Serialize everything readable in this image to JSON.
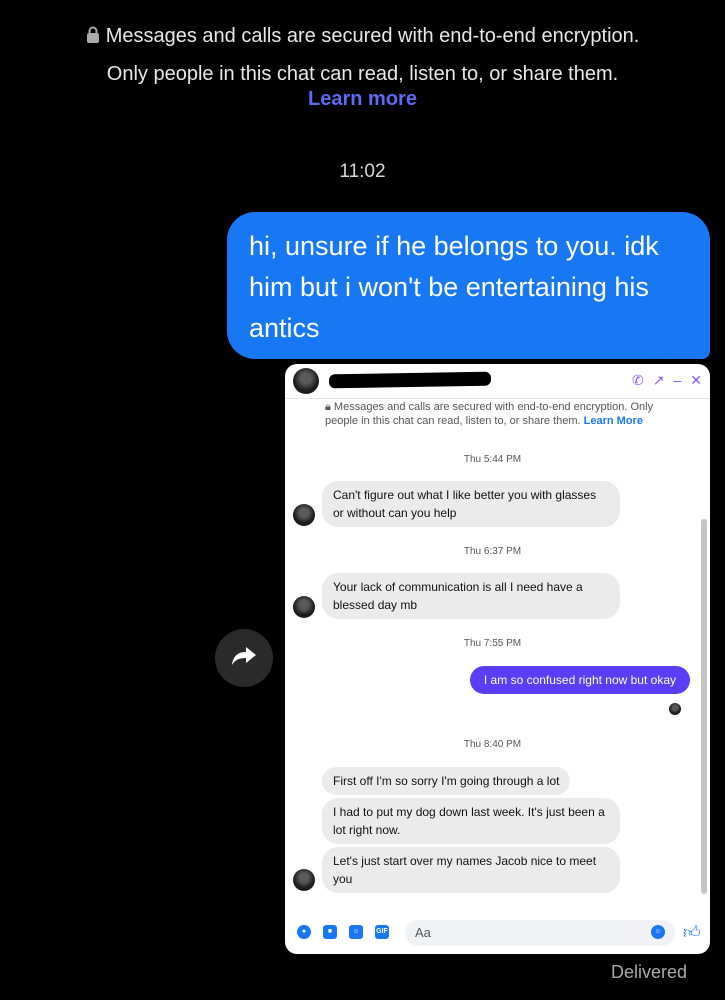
{
  "encryption": {
    "line1": "Messages and calls are secured with end-to-end encryption.",
    "line2": "Only people in this chat can read, listen to, or share them.",
    "learn_more": "Learn more"
  },
  "timestamp": "11:02",
  "sent_message": "hi, unsure if he belongs to you. idk him but i won't be entertaining his antics",
  "delivered": "Delivered",
  "screenshot": {
    "encryption_text": "Messages and calls are secured with end-to-end encryption. Only people in this chat can read, listen to, or share them.",
    "learn_more": "Learn More",
    "times": [
      "Thu 5:44 PM",
      "Thu 6:37 PM",
      "Thu 7:55 PM",
      "Thu 8:40 PM"
    ],
    "messages": [
      "Can't figure out what I like better you with glasses or without can you help",
      "Your lack of communication is all I need have a blessed day mb",
      "I am so confused right now but okay",
      "First off I'm so sorry I'm going through a lot",
      "I had to put my dog down last week. It's just been a lot right now.",
      "Let's just start over my names Jacob nice to meet you"
    ],
    "composer_placeholder": "Aa",
    "gif_label": "GIF"
  },
  "colors": {
    "sent_bubble": "#1877f2",
    "link": "#5b6cf2",
    "mini_sent_bubble": "#5b3df5"
  }
}
